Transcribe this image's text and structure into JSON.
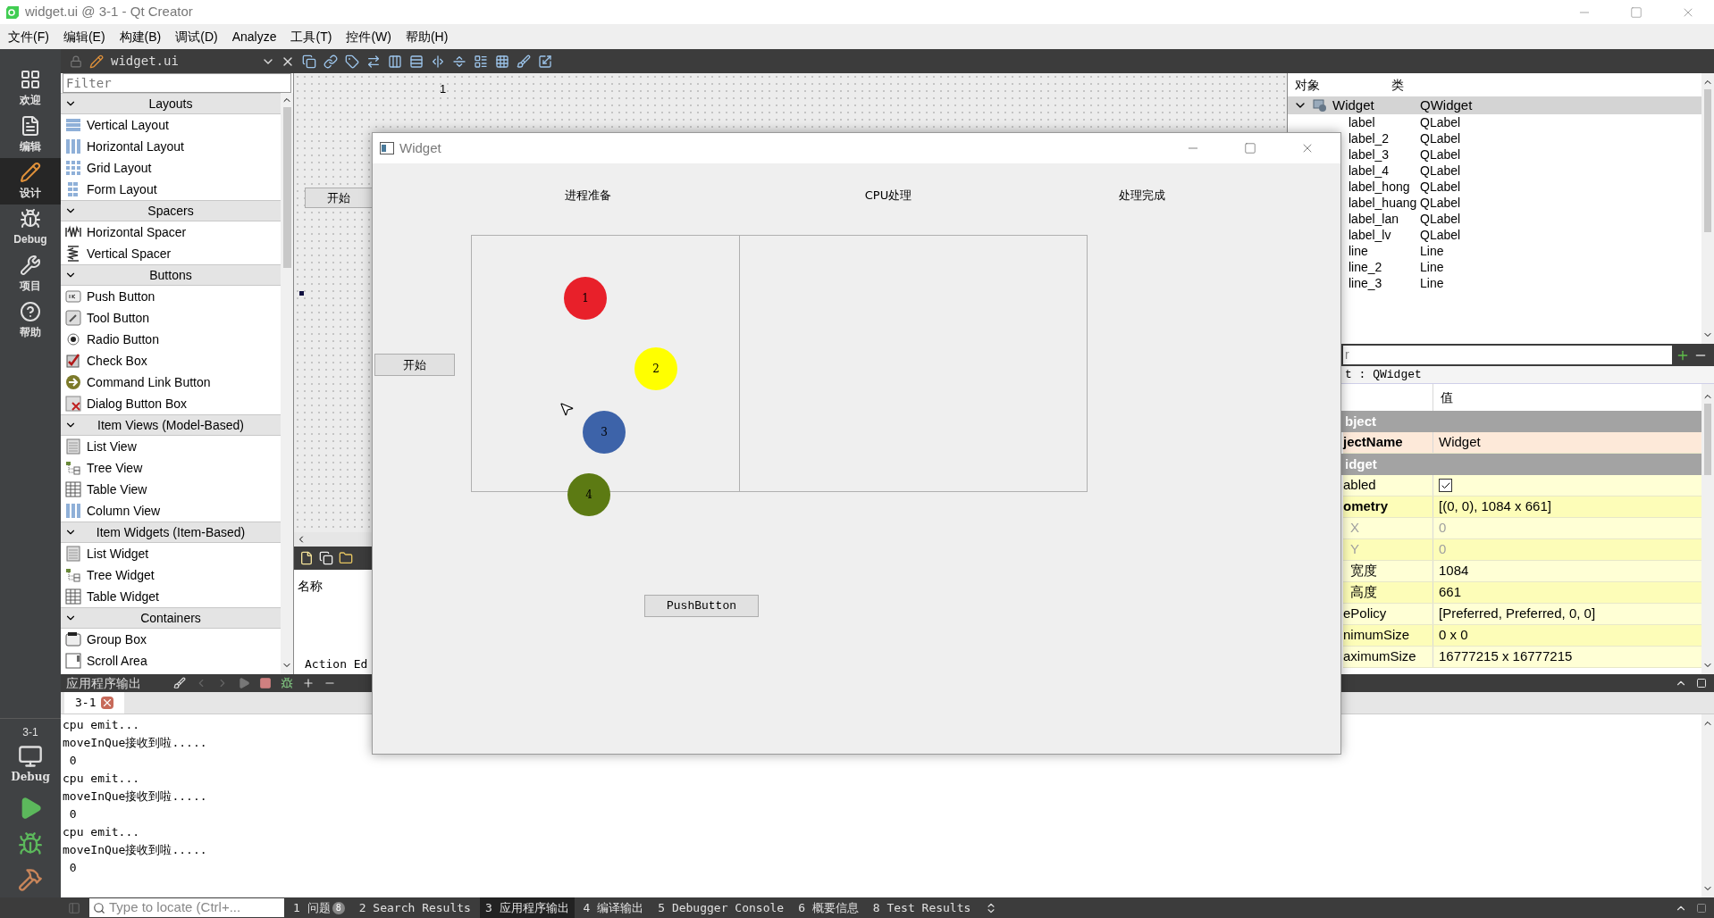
{
  "window": {
    "title": "widget.ui @ 3-1 - Qt Creator"
  },
  "menu": [
    "文件(F)",
    "编辑(E)",
    "构建(B)",
    "调试(D)",
    "Analyze",
    "工具(T)",
    "控件(W)",
    "帮助(H)"
  ],
  "modes": [
    {
      "label": "欢迎",
      "kind": "welcome",
      "selected": false
    },
    {
      "label": "编辑",
      "kind": "edit",
      "selected": false
    },
    {
      "label": "设计",
      "kind": "design",
      "selected": true
    },
    {
      "label": "Debug",
      "kind": "debug",
      "selected": false
    },
    {
      "label": "项目",
      "kind": "projects",
      "selected": false
    },
    {
      "label": "帮助",
      "kind": "help",
      "selected": false
    }
  ],
  "run_target": {
    "project": "3-1",
    "config": "Debug"
  },
  "editor_toolbar": {
    "file": "widget.ui"
  },
  "widget_box": {
    "filter_placeholder": "Filter",
    "categories": [
      {
        "title": "Layouts",
        "items": [
          {
            "label": "Vertical Layout",
            "kind": "vlayout"
          },
          {
            "label": "Horizontal Layout",
            "kind": "hlayout"
          },
          {
            "label": "Grid Layout",
            "kind": "grid"
          },
          {
            "label": "Form Layout",
            "kind": "form"
          }
        ]
      },
      {
        "title": "Spacers",
        "items": [
          {
            "label": "Horizontal Spacer",
            "kind": "hspacer"
          },
          {
            "label": "Vertical Spacer",
            "kind": "vspacer"
          }
        ]
      },
      {
        "title": "Buttons",
        "items": [
          {
            "label": "Push Button",
            "kind": "push"
          },
          {
            "label": "Tool Button",
            "kind": "tool"
          },
          {
            "label": "Radio Button",
            "kind": "radio"
          },
          {
            "label": "Check Box",
            "kind": "check"
          },
          {
            "label": "Command Link Button",
            "kind": "cmdlink"
          },
          {
            "label": "Dialog Button Box",
            "kind": "dialog"
          }
        ]
      },
      {
        "title": "Item Views (Model-Based)",
        "items": [
          {
            "label": "List View",
            "kind": "list"
          },
          {
            "label": "Tree View",
            "kind": "tree"
          },
          {
            "label": "Table View",
            "kind": "table"
          },
          {
            "label": "Column View",
            "kind": "column"
          }
        ]
      },
      {
        "title": "Item Widgets (Item-Based)",
        "items": [
          {
            "label": "List Widget",
            "kind": "list"
          },
          {
            "label": "Tree Widget",
            "kind": "tree"
          },
          {
            "label": "Table Widget",
            "kind": "table"
          }
        ]
      },
      {
        "title": "Containers",
        "items": [
          {
            "label": "Group Box",
            "kind": "group"
          },
          {
            "label": "Scroll Area",
            "kind": "scroll"
          }
        ]
      }
    ]
  },
  "designer": {
    "column_1": "1",
    "start_button": "开始"
  },
  "action_editor": {
    "column_header": "名称",
    "tab": "Action Ed"
  },
  "preview_window": {
    "title": "Widget",
    "headings": [
      "进程准备",
      "CPU处理",
      "处理完成"
    ],
    "start_button": "开始",
    "push_button": "PushButton",
    "balls": [
      {
        "label": "1",
        "color": "#e8202a"
      },
      {
        "label": "2",
        "color": "#ffff00"
      },
      {
        "label": "3",
        "color": "#3d63a9"
      },
      {
        "label": "4",
        "color": "#5c7a13"
      }
    ]
  },
  "object_inspector": {
    "columns": [
      "对象",
      "类"
    ],
    "root": {
      "name": "Widget",
      "class": "QWidget",
      "selected": true,
      "expanded": true,
      "children": [
        {
          "name": "label",
          "class": "QLabel"
        },
        {
          "name": "label_2",
          "class": "QLabel"
        },
        {
          "name": "label_3",
          "class": "QLabel"
        },
        {
          "name": "label_4",
          "class": "QLabel"
        },
        {
          "name": "label_hong",
          "class": "QLabel"
        },
        {
          "name": "label_huang",
          "class": "QLabel"
        },
        {
          "name": "label_lan",
          "class": "QLabel"
        },
        {
          "name": "label_lv",
          "class": "QLabel"
        },
        {
          "name": "line",
          "class": "Line"
        },
        {
          "name": "line_2",
          "class": "Line"
        },
        {
          "name": "line_3",
          "class": "Line"
        }
      ]
    }
  },
  "property_editor": {
    "filter_placeholder": "r",
    "caption": "t : QWidget",
    "value_header": "值",
    "rows": [
      {
        "kind": "group",
        "name": "bject"
      },
      {
        "kind": "text",
        "name": "jectName",
        "value": "Widget",
        "color": "#fde9d9",
        "modified": true,
        "disabled": false
      },
      {
        "kind": "group",
        "name": "idget"
      },
      {
        "kind": "checkbox",
        "name": "abled",
        "checked": true,
        "color": "#ffffd5",
        "modified": false,
        "disabled": false
      },
      {
        "kind": "text",
        "name": "ometry",
        "value": "[(0, 0), 1084 x 661]",
        "color": "#fdfdb8",
        "modified": true,
        "disabled": false
      },
      {
        "kind": "text",
        "name": "X",
        "value": "0",
        "color": "#ffffd5",
        "modified": false,
        "disabled": true,
        "child": true
      },
      {
        "kind": "text",
        "name": "Y",
        "value": "0",
        "color": "#fdfdb8",
        "modified": false,
        "disabled": true,
        "child": true
      },
      {
        "kind": "text",
        "name": "宽度",
        "value": "1084",
        "color": "#ffffd5",
        "modified": false,
        "disabled": false,
        "child": true
      },
      {
        "kind": "text",
        "name": "高度",
        "value": "661",
        "color": "#fdfdb8",
        "modified": false,
        "disabled": false,
        "child": true
      },
      {
        "kind": "text",
        "name": "ePolicy",
        "value": "[Preferred, Preferred, 0, 0]",
        "color": "#ffffd5",
        "modified": false,
        "disabled": false
      },
      {
        "kind": "text",
        "name": "nimumSize",
        "value": "0 x 0",
        "color": "#fdfdb8",
        "modified": false,
        "disabled": false
      },
      {
        "kind": "text",
        "name": "aximumSize",
        "value": "16777215 x 16777215",
        "color": "#ffffd5",
        "modified": false,
        "disabled": false
      }
    ]
  },
  "output": {
    "title": "应用程序输出",
    "tabs": [
      {
        "label": "3-1",
        "selected": true
      }
    ],
    "lines": [
      "cpu emit...",
      "moveInQue接收到啦.....",
      " 0",
      "cpu emit...",
      "moveInQue接收到啦.....",
      " 0",
      "cpu emit...",
      "moveInQue接收到啦.....",
      " 0"
    ]
  },
  "status_bar": {
    "locator_placeholder": "Type to locate (Ctrl+...",
    "panes": [
      {
        "label": "1 问题",
        "badge": "8",
        "selected": false
      },
      {
        "label": "2 Search Results",
        "selected": false
      },
      {
        "label": "3 应用程序输出",
        "selected": true
      },
      {
        "label": "4 编译输出",
        "selected": false
      },
      {
        "label": "5 Debugger Console",
        "selected": false
      },
      {
        "label": "6 概要信息",
        "selected": false
      },
      {
        "label": "8 Test Results",
        "selected": false
      }
    ]
  }
}
